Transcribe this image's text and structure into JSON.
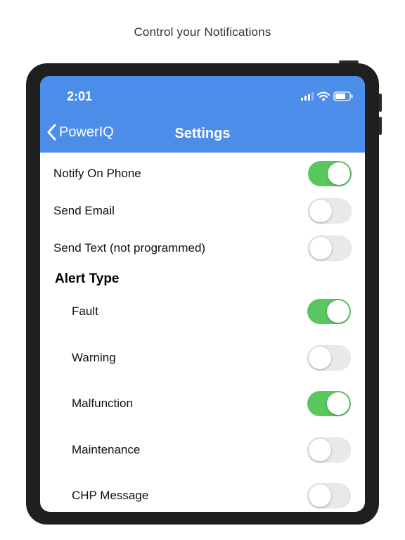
{
  "caption": "Control your Notifications",
  "status_bar": {
    "time": "2:01",
    "icons": [
      "signal-icon",
      "wifi-icon",
      "battery-icon"
    ]
  },
  "nav": {
    "back_label": "PowerIQ",
    "title": "Settings"
  },
  "colors": {
    "header": "#4c8dea",
    "toggle_on": "#5ac660",
    "toggle_off": "#e9e9ea"
  },
  "settings": [
    {
      "label": "Notify On Phone",
      "on": true
    },
    {
      "label": "Send Email",
      "on": false
    },
    {
      "label": "Send Text (not programmed)",
      "on": false
    }
  ],
  "alert_type": {
    "title": "Alert Type",
    "items": [
      {
        "label": "Fault",
        "on": true
      },
      {
        "label": "Warning",
        "on": false
      },
      {
        "label": "Malfunction",
        "on": true
      },
      {
        "label": "Maintenance",
        "on": false
      },
      {
        "label": "CHP Message",
        "on": false
      }
    ]
  }
}
